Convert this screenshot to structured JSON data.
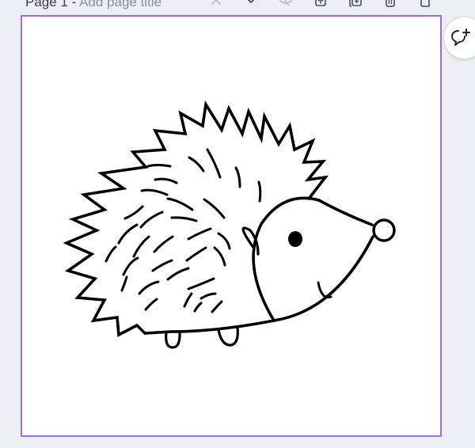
{
  "header": {
    "page_number_label": "Page 1 - ",
    "page_title_placeholder": "Add page title"
  },
  "toolbar": {
    "icons": [
      "chevron-up-icon",
      "chevron-down-icon",
      "hide-icon",
      "export-icon",
      "duplicate-page-icon",
      "delete-icon",
      "add-page-icon"
    ]
  },
  "canvas": {
    "subject": "hedgehog-line-art",
    "selection_color": "#9b6ee8",
    "background": "#ffffff"
  },
  "side_actions": {
    "comment_icon": "add-comment-icon"
  },
  "colors": {
    "workspace_bg": "#eceef3",
    "text_dark": "#3b3f47",
    "text_muted": "#8a8f99"
  }
}
